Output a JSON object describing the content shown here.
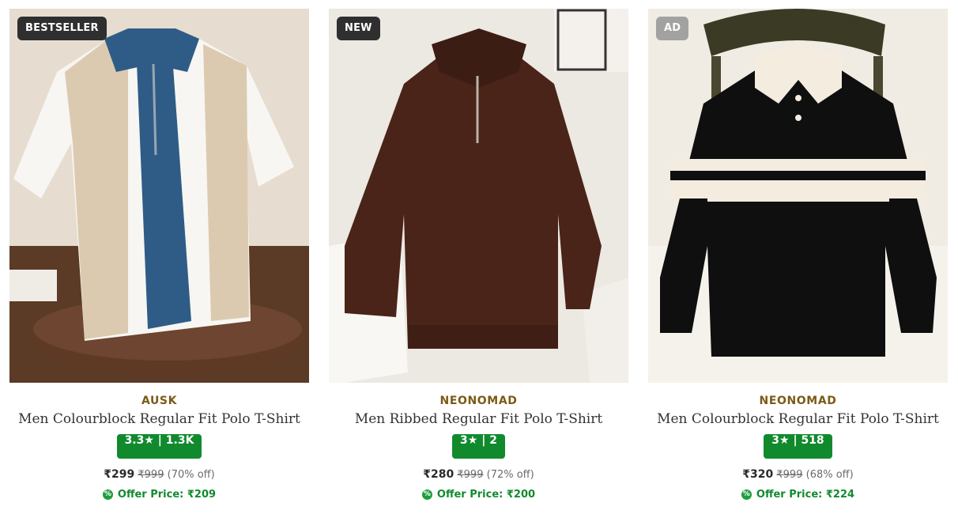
{
  "products": [
    {
      "badge": "BESTSELLER",
      "brand": "AUSK",
      "title": "Men Colourblock Regular Fit Polo T-Shirt",
      "rating": "3.3★ | 1.3K",
      "price": "₹299",
      "mrp": "₹999",
      "discount": "(70% off)",
      "offer_icon": "%",
      "offer_price": "Offer Price: ₹209"
    },
    {
      "badge": "NEW",
      "brand": "NEONOMAD",
      "title": "Men Ribbed Regular Fit Polo T-Shirt",
      "rating": "3★ | 2",
      "price": "₹280",
      "mrp": "₹999",
      "discount": "(72% off)",
      "offer_icon": "%",
      "offer_price": "Offer Price: ₹200"
    },
    {
      "badge": "AD",
      "brand": "NEONOMAD",
      "title": "Men Colourblock Regular Fit Polo T-Shirt",
      "rating": "3★ | 518",
      "price": "₹320",
      "mrp": "₹999",
      "discount": "(68% off)",
      "offer_icon": "%",
      "offer_price": "Offer Price: ₹224"
    }
  ],
  "colors": {
    "brand_text": "#7a5a17",
    "rating_bg": "#118a2e",
    "offer_text": "#118a2e",
    "badge_dark": "#2f2f2f",
    "badge_ad": "#9a9a9a"
  }
}
